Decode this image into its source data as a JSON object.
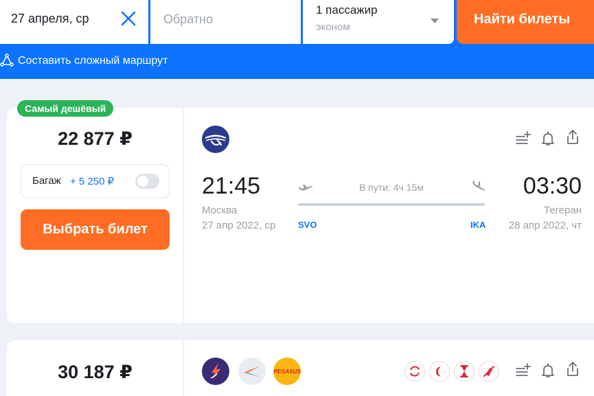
{
  "search": {
    "depart_date": "27 апреля, ср",
    "return_placeholder": "Обратно",
    "passengers": "1 пассажир",
    "cabin": "эконом",
    "find_label": "Найти билеты"
  },
  "route_link": {
    "label": "Составить сложный маршрут"
  },
  "tickets": [
    {
      "badge": "Самый дешёвый",
      "price": "22 877 ₽",
      "baggage_label": "Багаж",
      "baggage_price": "+ 5 250 ₽",
      "select_label": "Выбрать билет",
      "depart_time": "21:45",
      "depart_city": "Москва",
      "depart_date": "27 апр 2022, ср",
      "depart_iata": "SVO",
      "duration": "В пути: 4ч 15м",
      "arrive_time": "03:30",
      "arrive_city": "Тегеран",
      "arrive_date": "28 апр 2022, чт",
      "arrive_iata": "IKA",
      "airlines": [
        "aeroflot-logo"
      ]
    },
    {
      "price": "30 187 ₽",
      "airlines": [
        "rossiya-logo",
        "s7-logo",
        "pegasus-logo"
      ],
      "pegasus_text": "PEGASUS"
    }
  ],
  "colors": {
    "brand_blue": "#0c73fe",
    "accent_orange": "#ff6d24",
    "badge_green": "#29b458"
  }
}
